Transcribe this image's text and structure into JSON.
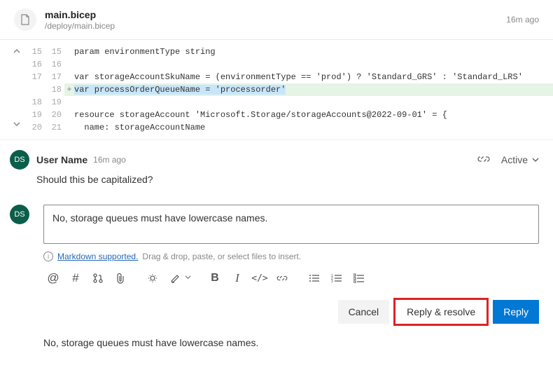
{
  "file": {
    "name": "main.bicep",
    "path": "/deploy/main.bicep",
    "time_ago": "16m ago"
  },
  "diff": {
    "rows": [
      {
        "oldLn": "15",
        "newLn": "15",
        "marker": " ",
        "prefix": "param environmentType string",
        "hl": "",
        "suffix": "",
        "added": false
      },
      {
        "oldLn": "16",
        "newLn": "16",
        "marker": " ",
        "prefix": "",
        "hl": "",
        "suffix": "",
        "added": false
      },
      {
        "oldLn": "17",
        "newLn": "17",
        "marker": " ",
        "prefix": "var storageAccountSkuName = (environmentType == 'prod') ? 'Standard_GRS' : 'Standard_LRS'",
        "hl": "",
        "suffix": "",
        "added": false
      },
      {
        "oldLn": "",
        "newLn": "18",
        "marker": "+",
        "prefix": "",
        "hl": "var processOrderQueueName = 'processorder'",
        "suffix": "",
        "added": true
      },
      {
        "oldLn": "18",
        "newLn": "19",
        "marker": " ",
        "prefix": "",
        "hl": "",
        "suffix": "",
        "added": false
      },
      {
        "oldLn": "19",
        "newLn": "20",
        "marker": " ",
        "prefix": "resource storageAccount 'Microsoft.Storage/storageAccounts@2022-09-01' = {",
        "hl": "",
        "suffix": "",
        "added": false
      },
      {
        "oldLn": "20",
        "newLn": "21",
        "marker": " ",
        "prefix": "  name: storageAccountName",
        "hl": "",
        "suffix": "",
        "added": false
      }
    ]
  },
  "thread": {
    "avatar_initials": "DS",
    "user": "User Name",
    "time_ago": "16m ago",
    "status": "Active",
    "body": "Should this be capitalized?"
  },
  "reply": {
    "avatar_initials": "DS",
    "text": "No, storage queues must have lowercase names.",
    "hint_link": "Markdown supported.",
    "hint_rest": "Drag & drop, paste, or select files to insert."
  },
  "toolbar": {
    "mention": "@",
    "hash": "#",
    "pr": "pr",
    "attach": "attach",
    "bulb": "bulb",
    "highlighter": "hl",
    "bold": "B",
    "italic": "I",
    "code": "</>",
    "link": "link",
    "ul": "ul",
    "ol": "ol",
    "task": "task"
  },
  "actions": {
    "cancel": "Cancel",
    "reply_resolve": "Reply & resolve",
    "reply": "Reply"
  },
  "preview": "No, storage queues must have lowercase names."
}
